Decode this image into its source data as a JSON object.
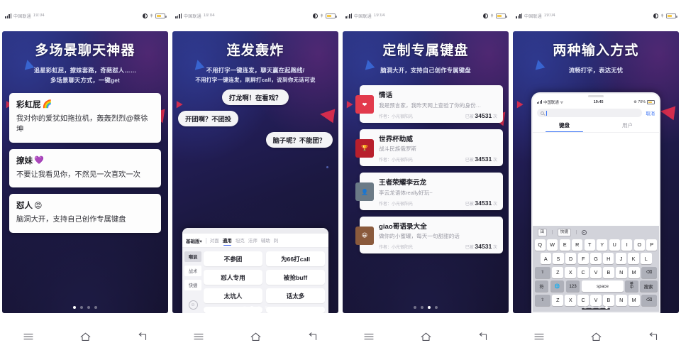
{
  "device": {
    "status_bar": {
      "left_text": "中国联通",
      "time": "19:04",
      "right_icons": [
        "signal-icon",
        "dnd-icon",
        "vibrate-icon",
        "battery-icon"
      ]
    },
    "nav_bar": {
      "menu_label": "menu-icon",
      "home_label": "home-icon",
      "back_label": "back-icon"
    }
  },
  "screens": [
    {
      "id": "screen-1",
      "title": "多场景聊天神器",
      "subtitle_line1": "追星彩虹屁，撩妹套路，奇葩怼人……",
      "subtitle_line2": "多场景聊天方式，一键get",
      "dots": {
        "count": 4,
        "active": 0
      },
      "cards": [
        {
          "title": "彩虹屁",
          "emoji": "🌈",
          "text": "我对你的爱犹如拖拉机，轰轰烈烈@蔡徐坤"
        },
        {
          "title": "撩妹",
          "emoji": "💜",
          "text": "不要让我看见你，不然见一次喜欢一次"
        },
        {
          "title": "怼人",
          "emoji": "😡",
          "text": "脑洞大开，支持自己创作专属键盘"
        }
      ]
    },
    {
      "id": "screen-2",
      "title": "连发轰炸",
      "subtitle_line1": "不用打字一键连发，聊天赢在起跑线/",
      "subtitle_line2": "不用打字一键连发，刷屏打call，说到你无话可说",
      "dots": {
        "count": 4,
        "active": 1
      },
      "bubbles": [
        {
          "align": "center",
          "text": "打龙啊！在看戏？"
        },
        {
          "align": "left",
          "text": "开团啊？不团投"
        },
        {
          "align": "right",
          "text": "脑子呢？不能团？"
        }
      ],
      "keyboard_panel": {
        "version_label": "基础版",
        "version_caret": "▾",
        "tabs": [
          "对面",
          "通用",
          "坦克",
          "法师",
          "辅助",
          "刺"
        ],
        "active_tab": "通用",
        "side_items": [
          "嘲讽",
          "战术",
          "快捷"
        ],
        "side_active": "嘲讽",
        "side_emoji_icon": "smiley-icon",
        "chips": [
          "不参团",
          "为66打call",
          "怼人专用",
          "被抢buff",
          "太坑人",
          "话太多"
        ]
      }
    },
    {
      "id": "screen-3",
      "title": "定制专属键盘",
      "subtitle_line1": "脑洞大开，支持自己创作专属键盘",
      "subtitle_line2": "",
      "dots": {
        "count": 4,
        "active": 2
      },
      "list": [
        {
          "title": "情话",
          "desc": "我是预言家，我昨天网上查验了你的身份…",
          "author": "作者：小光很阳光",
          "used_prefix": "已被",
          "used_count": "34531",
          "used_suffix": "次",
          "thumb_color": "#e23a4c"
        },
        {
          "title": "世界杯助威",
          "desc": "战斗民族俄罗斯",
          "author": "作者：小光很阳光",
          "used_prefix": "已被",
          "used_count": "34531",
          "used_suffix": "次",
          "thumb_color": "#b81f2c"
        },
        {
          "title": "王者荣耀李云龙",
          "desc": "李云龙语体really好玩~",
          "author": "作者：小光很阳光",
          "used_prefix": "已被",
          "used_count": "34531",
          "used_suffix": "次",
          "thumb_color": "#6b7a86"
        },
        {
          "title": "giao哥语录大全",
          "desc": "做你的小蜜罐，每天一句甜甜的话",
          "author": "作者：小光很阳光",
          "used_prefix": "已被",
          "used_count": "34531",
          "used_suffix": "次",
          "thumb_color": "#8a5a3c"
        }
      ]
    },
    {
      "id": "screen-4",
      "title": "两种输入方式",
      "subtitle_line1": "流畅打字，表达无忧",
      "subtitle_line2": "",
      "dots": {
        "count": 4,
        "active": 3
      },
      "phone": {
        "status": {
          "carrier": "中国联通",
          "time": "19:45",
          "battery": "70%"
        },
        "search_placeholder": "",
        "cancel_label": "取消",
        "tabs": [
          "键盘",
          "用户"
        ],
        "active_tab": "键盘",
        "keyboard": {
          "toolbar": {
            "grid_label": "田",
            "quick_label": "快捷",
            "emoji_icon": "smiley-icon"
          },
          "row1": [
            "Q",
            "W",
            "E",
            "R",
            "T",
            "Y",
            "U",
            "I",
            "O",
            "P"
          ],
          "row2": [
            "A",
            "S",
            "D",
            "F",
            "G",
            "H",
            "J",
            "K",
            "L"
          ],
          "row3": [
            "⇧",
            "Z",
            "X",
            "C",
            "V",
            "B",
            "N",
            "M",
            "⌫"
          ],
          "row4": [
            "符",
            "🌐",
            "123",
            "space",
            "英 中",
            "搜索"
          ],
          "space_label": "space",
          "lang_top": "英",
          "lang_bottom": "中",
          "search_key": "搜索",
          "num_key": "123",
          "sym_key": "符",
          "globe_icon": "globe-icon",
          "shift_icon": "shift-icon",
          "delete_icon": "backspace-icon"
        },
        "mini_row": [
          "⇧",
          "Z",
          "X",
          "C",
          "V",
          "B",
          "N",
          "M",
          "⌫"
        ]
      }
    }
  ]
}
